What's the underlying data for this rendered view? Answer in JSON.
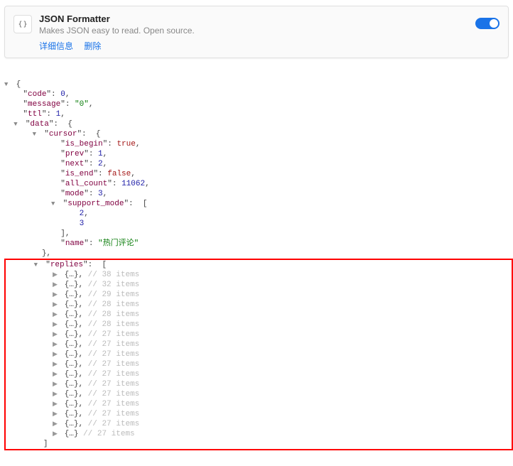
{
  "extension": {
    "title": "JSON Formatter",
    "description": "Makes JSON easy to read. Open source.",
    "detailsLink": "详细信息",
    "removeLink": "删除"
  },
  "json": {
    "keys": {
      "code": "code",
      "message": "message",
      "ttl": "ttl",
      "data": "data",
      "cursor": "cursor",
      "is_begin": "is_begin",
      "prev": "prev",
      "next": "next",
      "is_end": "is_end",
      "all_count": "all_count",
      "mode": "mode",
      "support_mode": "support_mode",
      "name": "name",
      "replies": "replies"
    },
    "values": {
      "code": "0",
      "message": "\"0\"",
      "ttl": "1",
      "is_begin": "true",
      "prev": "1",
      "next": "2",
      "is_end": "false",
      "all_count": "11062",
      "mode": "3",
      "support_mode_0": "2",
      "support_mode_1": "3",
      "name": "\"热门评论\""
    },
    "replies": [
      {
        "count": "38"
      },
      {
        "count": "32"
      },
      {
        "count": "29"
      },
      {
        "count": "28"
      },
      {
        "count": "28"
      },
      {
        "count": "28"
      },
      {
        "count": "27"
      },
      {
        "count": "27"
      },
      {
        "count": "27"
      },
      {
        "count": "27"
      },
      {
        "count": "27"
      },
      {
        "count": "27"
      },
      {
        "count": "27"
      },
      {
        "count": "27"
      },
      {
        "count": "27"
      },
      {
        "count": "27"
      },
      {
        "count": "27"
      }
    ],
    "replyTemplate": {
      "obj": "{…}",
      "commentPrefix": "// ",
      "itemsSuffix": " items"
    }
  }
}
